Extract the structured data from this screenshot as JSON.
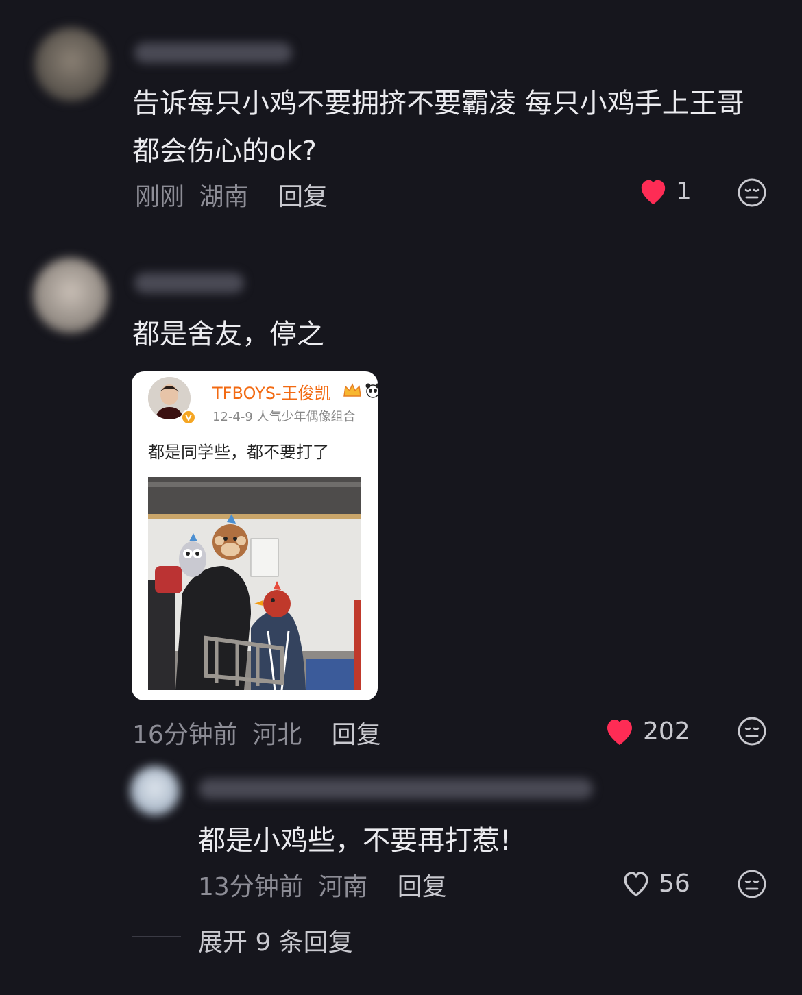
{
  "comments": [
    {
      "text_line1": "告诉每只小鸡不要拥挤不要霸凌 每只小鸡手上王哥",
      "text_line2": "都会伤心的ok?",
      "time": "刚刚",
      "location": "湖南",
      "reply_label": "回复",
      "likes": "1",
      "liked": true
    },
    {
      "text": "都是舍友，停之",
      "time": "16分钟前",
      "location": "河北",
      "reply_label": "回复",
      "likes": "202",
      "liked": true,
      "card": {
        "author": "TFBOYS-王俊凯",
        "meta": "12-4-9  人气少年偶像组合",
        "text": "都是同学些，都不要打了"
      }
    }
  ],
  "sub_reply": {
    "text": "都是小鸡些，不要再打惹!",
    "time": "13分钟前",
    "location": "河南",
    "reply_label": "回复",
    "likes": "56",
    "liked": false
  },
  "expand_label": "展开 9 条回复",
  "colors": {
    "like_red": "#fe2c55",
    "background": "#16161d"
  }
}
